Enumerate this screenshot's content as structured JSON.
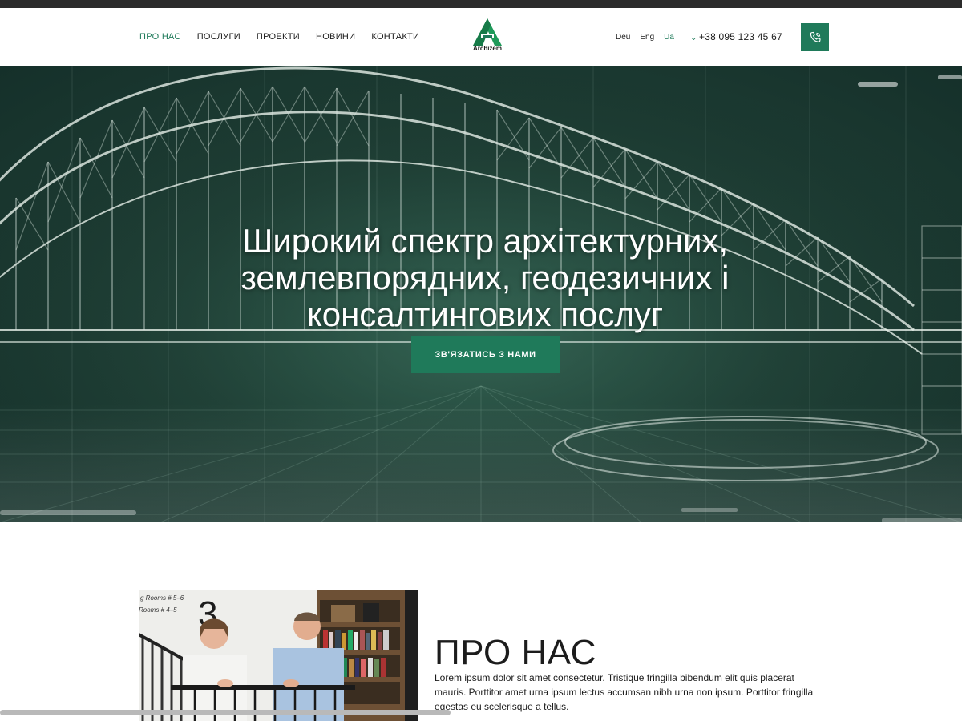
{
  "header": {
    "nav": [
      {
        "label": "ПРО НАС",
        "active": true
      },
      {
        "label": "ПОСЛУГИ",
        "active": false
      },
      {
        "label": "ПРОЕКТИ",
        "active": false
      },
      {
        "label": "НОВИНИ",
        "active": false
      },
      {
        "label": "КОНТАКТИ",
        "active": false
      }
    ],
    "logo_text": "Archizem",
    "languages": [
      {
        "label": "Deu",
        "active": false
      },
      {
        "label": "Eng",
        "active": false
      },
      {
        "label": "Ua",
        "active": true
      }
    ],
    "phone": "+38 095 123 45 67",
    "phone_icon": "phone-icon"
  },
  "hero": {
    "title": "Широкий спектр архітектурних, землевпорядних, геодезичних і консалтингових послуг",
    "cta": "ЗВ'ЯЗАТИСЬ З НАМИ"
  },
  "about": {
    "title": "ПРО НАС",
    "text": "Lorem ipsum dolor sit amet consectetur. Tristique fringilla bibendum elit quis placerat mauris. Porttitor amet urna ipsum lectus accumsan nibh urna non ipsum. Porttitor fringilla egestas eu scelerisque a tellus.",
    "photo_sign": [
      "g Rooms # 5–6",
      "Rooms # 4–5"
    ],
    "photo_number": "3"
  },
  "colors": {
    "accent": "#1f7a5a",
    "hero_dark": "#1f3f35",
    "text": "#1c1c1c"
  }
}
